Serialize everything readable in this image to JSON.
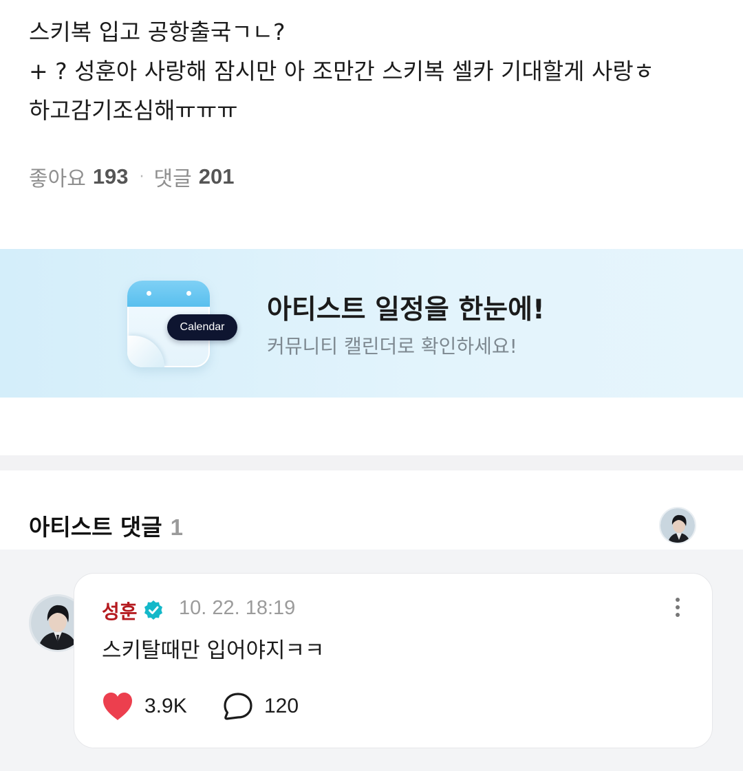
{
  "post": {
    "lines": [
      "스키복 입고 공항출국ㄱㄴ?",
      "+ ? 성훈아 사랑해 잠시만 아 조만간 스키복 셀카 기대할게 사랑ㅎ",
      "하고감기조심해ㅠㅠㅠ"
    ],
    "likes_label": "좋아요",
    "likes_count": "193",
    "comments_label": "댓글",
    "comments_count": "201",
    "separator": "·"
  },
  "banner": {
    "pill_label": "Calendar",
    "title": "아티스트 일정을 한눈에!",
    "subtitle": "커뮤니티 캘린더로 확인하세요!"
  },
  "artist_comments": {
    "title": "아티스트 댓글",
    "count": "1",
    "items": [
      {
        "author": "성훈",
        "timestamp": "10. 22. 18:19",
        "text": "스키탈때만 입어야지ㅋㅋ",
        "likes": "3.9K",
        "replies": "120"
      }
    ]
  },
  "colors": {
    "author": "#b51a1f",
    "verified": "#14b8c9",
    "heart": "#ec3f4e",
    "banner_bg": "#dff2fb",
    "pill_bg": "#0e1530"
  },
  "icons": [
    "calendar-icon",
    "verified-badge-icon",
    "more-vertical-icon",
    "heart-icon",
    "reply-bubble-icon"
  ]
}
